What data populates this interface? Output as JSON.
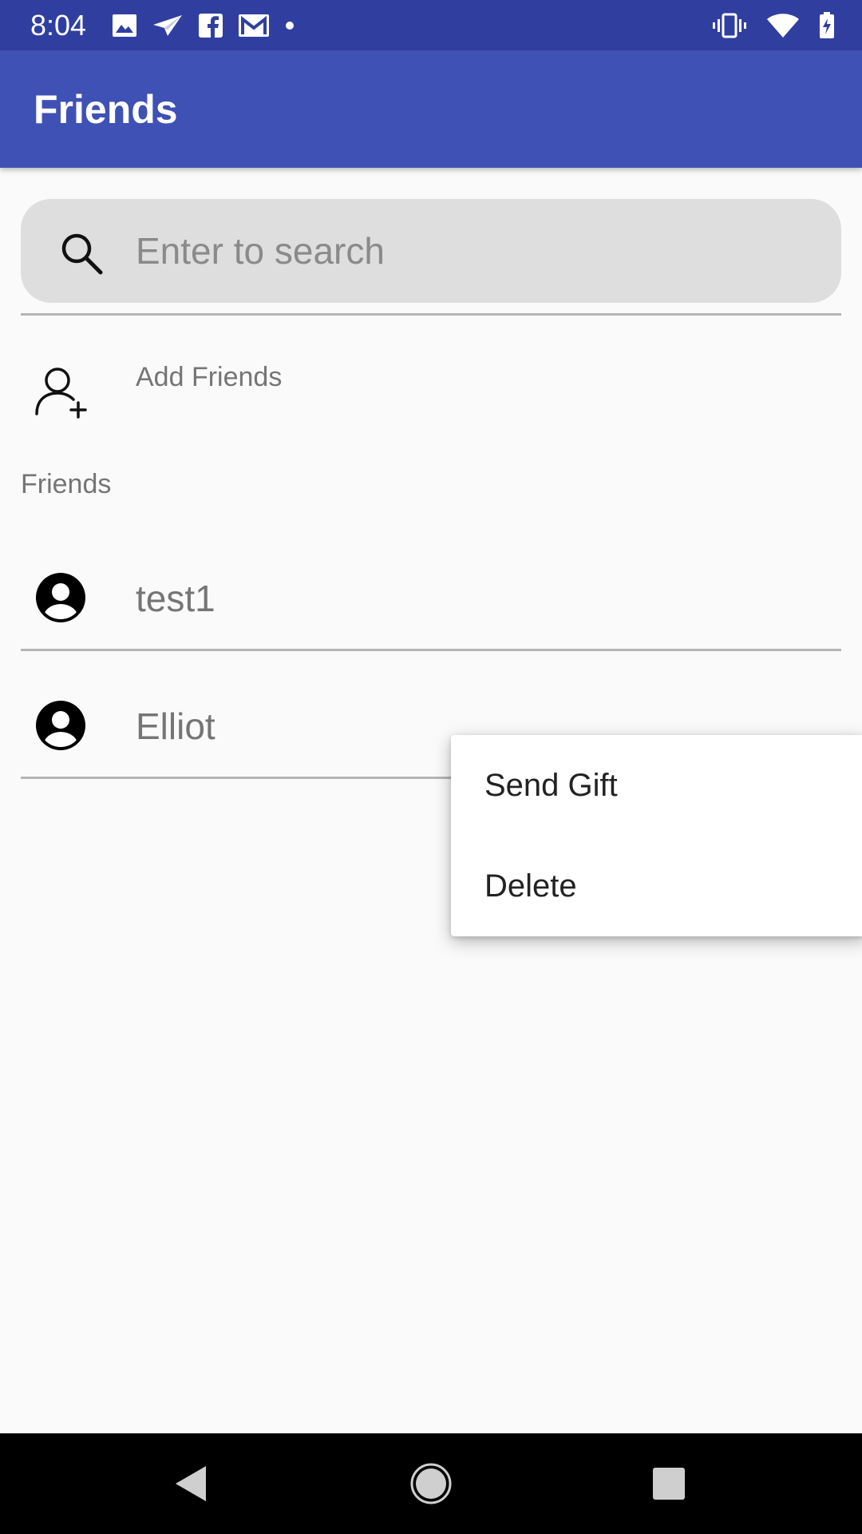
{
  "status_bar": {
    "time": "8:04",
    "left_icons": [
      "image-icon",
      "send-icon",
      "facebook-icon",
      "gmail-icon",
      "dot-icon"
    ],
    "right_icons": [
      "vibrate-icon",
      "wifi-icon",
      "battery-icon"
    ]
  },
  "app_bar": {
    "title": "Friends"
  },
  "search": {
    "placeholder": "Enter to search",
    "value": ""
  },
  "add_friends": {
    "label": "Add Friends",
    "icon": "add-person-icon"
  },
  "friends_section": {
    "label": "Friends",
    "items": [
      {
        "name": "test1",
        "icon": "avatar-icon"
      },
      {
        "name": "Elliot",
        "icon": "avatar-icon"
      }
    ]
  },
  "context_menu": {
    "items": [
      {
        "label": "Send Gift"
      },
      {
        "label": "Delete"
      }
    ]
  },
  "nav_bar": {
    "buttons": [
      "back-icon",
      "home-icon",
      "recents-icon"
    ]
  },
  "colors": {
    "status_bar": "#303f9f",
    "app_bar": "#3f51b5",
    "background": "#fafafa",
    "search_bg": "#dedede",
    "nav_bar": "#000000"
  }
}
